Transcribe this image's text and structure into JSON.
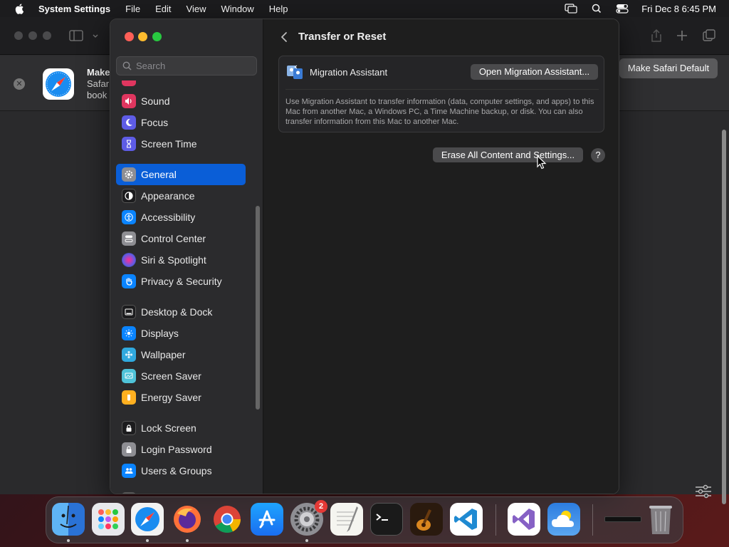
{
  "menubar": {
    "app_name": "System Settings",
    "menus": [
      "File",
      "Edit",
      "View",
      "Window",
      "Help"
    ],
    "clock": "Fri Dec 8  6:45 PM"
  },
  "safari": {
    "banner": {
      "title": "Make",
      "line2": "Safar",
      "line3": "book"
    },
    "make_default_label": "Make Safari Default"
  },
  "settings": {
    "search_placeholder": "Search",
    "sidebar_items": [
      {
        "label": "Sound",
        "icon": "sound-icon",
        "color": "#e0365f"
      },
      {
        "label": "Focus",
        "icon": "moon-icon",
        "color": "#5e5ce6"
      },
      {
        "label": "Screen Time",
        "icon": "hourglass-icon",
        "color": "#5e5ce6"
      },
      {
        "label": "General",
        "icon": "gear-icon",
        "color": "#8e8e93",
        "selected": true
      },
      {
        "label": "Appearance",
        "icon": "appearance-icon",
        "color": "#1c1c1e"
      },
      {
        "label": "Accessibility",
        "icon": "accessibility-icon",
        "color": "#0a84ff"
      },
      {
        "label": "Control Center",
        "icon": "control-center-icon",
        "color": "#8e8e93"
      },
      {
        "label": "Siri & Spotlight",
        "icon": "siri-icon",
        "color": "#b44bd1"
      },
      {
        "label": "Privacy & Security",
        "icon": "hand-icon",
        "color": "#0a84ff"
      },
      {
        "label": "Desktop & Dock",
        "icon": "desktop-icon",
        "color": "#1c1c1e"
      },
      {
        "label": "Displays",
        "icon": "sun-icon",
        "color": "#0a84ff"
      },
      {
        "label": "Wallpaper",
        "icon": "wallpaper-icon",
        "color": "#30a9de"
      },
      {
        "label": "Screen Saver",
        "icon": "screen-saver-icon",
        "color": "#4fc3d9"
      },
      {
        "label": "Energy Saver",
        "icon": "battery-icon",
        "color": "#ffb020"
      },
      {
        "label": "Lock Screen",
        "icon": "lock-icon",
        "color": "#1c1c1e"
      },
      {
        "label": "Login Password",
        "icon": "login-password-icon",
        "color": "#8e8e93"
      },
      {
        "label": "Users & Groups",
        "icon": "users-icon",
        "color": "#0a84ff"
      }
    ],
    "page_title": "Transfer or Reset",
    "migration": {
      "label": "Migration Assistant",
      "button": "Open Migration Assistant...",
      "description": "Use Migration Assistant to transfer information (data, computer settings, and apps) to this Mac from another Mac, a Windows PC, a Time Machine backup, or disk. You can also transfer information from this Mac to another Mac."
    },
    "erase_button": "Erase All Content and Settings...",
    "help_label": "?"
  },
  "dock": {
    "apps": [
      {
        "name": "finder-icon",
        "bg": "#3c8ee8"
      },
      {
        "name": "launchpad-icon",
        "bg": "#e8e8ec"
      },
      {
        "name": "safari-icon",
        "bg": "#f2f2f2"
      },
      {
        "name": "firefox-icon",
        "bg": "#5a2a7a"
      },
      {
        "name": "chrome-icon",
        "bg": "#ffffff"
      },
      {
        "name": "app-store-icon",
        "bg": "#1e7ef2"
      },
      {
        "name": "system-settings-icon",
        "bg": "#8e8e93"
      },
      {
        "name": "textedit-icon",
        "bg": "#f5f5f0"
      },
      {
        "name": "terminal-icon",
        "bg": "#1a1a1a"
      },
      {
        "name": "garageband-icon",
        "bg": "#3a2a1a"
      },
      {
        "name": "vscode-icon",
        "bg": "#ffffff"
      },
      {
        "name": "visual-studio-icon",
        "bg": "#ffffff"
      },
      {
        "name": "weather-icon",
        "bg": "#2c7de0"
      },
      {
        "name": "minimized-window-icon",
        "bg": "#2a2a2c"
      },
      {
        "name": "trash-icon",
        "bg": "transparent"
      }
    ],
    "settings_badge": "2"
  }
}
